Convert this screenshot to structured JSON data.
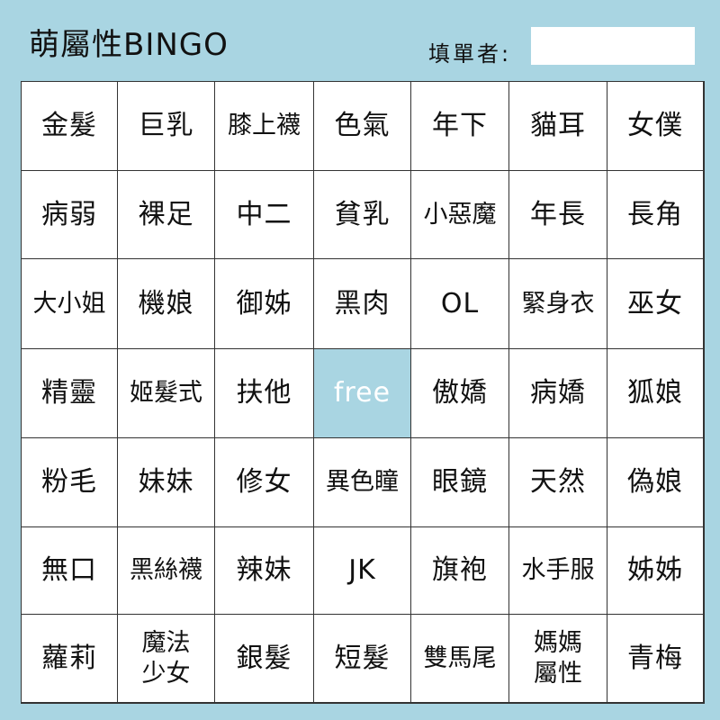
{
  "header": {
    "title": "萌屬性BINGO",
    "filler_label": "填單者:",
    "filler_value": ""
  },
  "board": {
    "rows": [
      [
        "金髮",
        "巨乳",
        "膝上襪",
        "色氣",
        "年下",
        "貓耳",
        "女僕"
      ],
      [
        "病弱",
        "裸足",
        "中二",
        "貧乳",
        "小惡魔",
        "年長",
        "長角"
      ],
      [
        "大小姐",
        "機娘",
        "御姊",
        "黑肉",
        "OL",
        "緊身衣",
        "巫女"
      ],
      [
        "精靈",
        "姬髮式",
        "扶他",
        "free",
        "傲嬌",
        "病嬌",
        "狐娘"
      ],
      [
        "粉毛",
        "妹妹",
        "修女",
        "異色瞳",
        "眼鏡",
        "天然",
        "偽娘"
      ],
      [
        "無口",
        "黑絲襪",
        "辣妹",
        "JK",
        "旗袍",
        "水手服",
        "姊姊"
      ],
      [
        "蘿莉",
        "魔法\n少女",
        "銀髮",
        "短髮",
        "雙馬尾",
        "媽媽\n屬性",
        "青梅"
      ]
    ],
    "free_cell_color": "#a9d5e2"
  },
  "colors": {
    "background": "#a9d5e2",
    "cell_background": "#ffffff",
    "grid_line": "#333333",
    "text": "#111111",
    "free_text": "#ffffff"
  }
}
